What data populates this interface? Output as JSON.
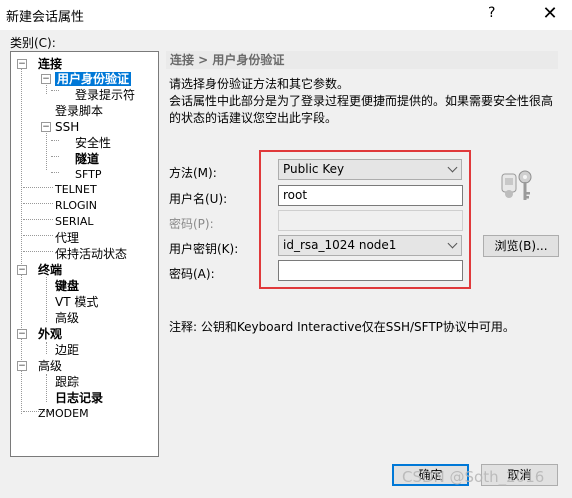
{
  "window": {
    "title": "新建会话属性",
    "help": "?",
    "close": "✕"
  },
  "category_label": "类别(C):",
  "tree": {
    "connection": "连接",
    "user_auth": "用户身份验证",
    "login_prompt": "登录提示符",
    "login_script": "登录脚本",
    "ssh": "SSH",
    "security": "安全性",
    "tunnel": "隧道",
    "sftp": "SFTP",
    "telnet": "TELNET",
    "rlogin": "RLOGIN",
    "serial": "SERIAL",
    "proxy": "代理",
    "keepalive": "保持活动状态",
    "terminal": "终端",
    "keyboard": "键盘",
    "vt_mode": "VT 模式",
    "advanced1": "高级",
    "appearance": "外观",
    "margin": "边距",
    "advanced2": "高级",
    "trace": "跟踪",
    "log": "日志记录",
    "zmodem": "ZMODEM"
  },
  "header": "连接 > 用户身份验证",
  "desc1": "请选择身份验证方法和其它参数。",
  "desc2": "会话属性中此部分是为了登录过程更便捷而提供的。如果需要安全性很高的状态的话建议您空出此字段。",
  "form": {
    "method_label": "方法(M):",
    "method_value": "Public Key",
    "username_label": "用户名(U):",
    "username_value": "root",
    "password_p_label": "密码(P):",
    "userkey_label": "用户密钥(K):",
    "userkey_value": "id_rsa_1024 node1",
    "browse_label": "浏览(B)...",
    "passphrase_label": "密码(A):",
    "passphrase_value": ""
  },
  "note": "注释: 公钥和Keyboard Interactive仅在SSH/SFTP协议中可用。",
  "buttons": {
    "ok": "确定",
    "cancel": "取消"
  },
  "watermark": "CSDN @Soth_2016",
  "colors": {
    "highlight": "#e0393b",
    "selection": "#0078d7"
  }
}
